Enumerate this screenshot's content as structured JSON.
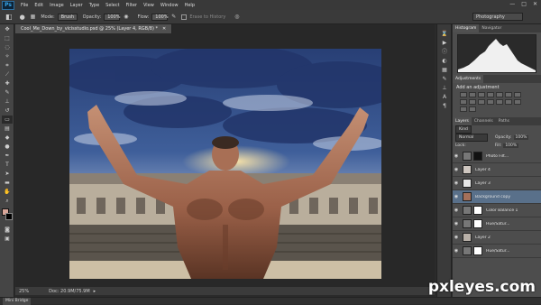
{
  "menubar": {
    "logo": "Ps",
    "items": [
      "File",
      "Edit",
      "Image",
      "Layer",
      "Type",
      "Select",
      "Filter",
      "View",
      "Window",
      "Help"
    ]
  },
  "options": {
    "mode_label": "Mode:",
    "mode_value": "Brush",
    "opacity_label": "Opacity:",
    "opacity_value": "100%",
    "flow_label": "Flow:",
    "flow_value": "100%",
    "erase_label": "Erase to History",
    "workspace": "Photography"
  },
  "document": {
    "tab_title": "Cool_Me_Down_by_vicisstudio.psd @ 25% (Layer 4, RGB/8) *",
    "zoom": "25%",
    "doc_size": "Doc: 20.9M/75.9M"
  },
  "panels": {
    "histogram_tabs": [
      "Histogram",
      "Navigator"
    ],
    "adjustments_tab": "Adjustments",
    "adjustments_title": "Add an adjustment",
    "layer_tabs": [
      "Layers",
      "Channels",
      "Paths"
    ],
    "kind": "Kind",
    "blend_mode": "Normal",
    "opacity_label": "Opacity:",
    "opacity_value": "100%",
    "lock_label": "Lock:",
    "fill_label": "Fill:",
    "fill_value": "100%",
    "layers": [
      {
        "name": "Photo Filt..."
      },
      {
        "name": "Layer 4"
      },
      {
        "name": "Layer 3"
      },
      {
        "name": "Background copy"
      },
      {
        "name": "Color Balance 1"
      },
      {
        "name": "Hue/Satur..."
      },
      {
        "name": "Layer 2"
      },
      {
        "name": "Hue/Satur..."
      }
    ]
  },
  "minibridge": "Mini Bridge",
  "watermark": "pxleyes.com"
}
